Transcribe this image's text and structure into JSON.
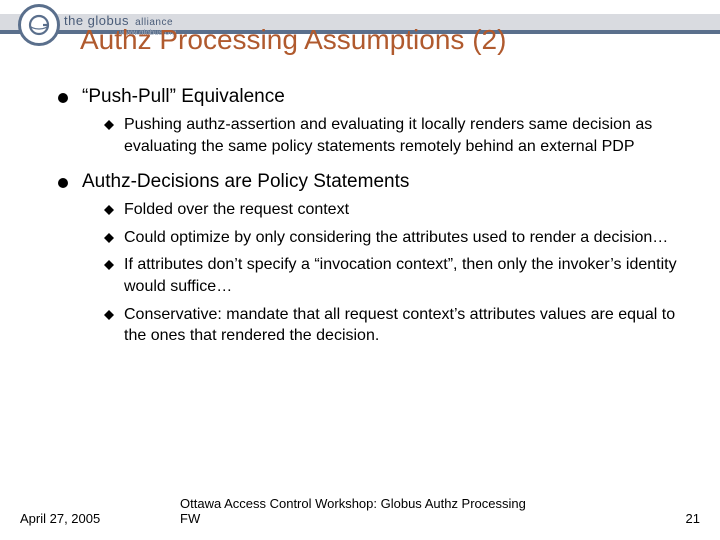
{
  "header": {
    "logo_text": "the globus",
    "logo_alliance": "alliance",
    "logo_url": "www.globus.org",
    "title": "Authz Processing Assumptions (2)"
  },
  "bullets": {
    "b1": {
      "label": "“Push-Pull” Equivalence",
      "subs": {
        "s1": "Pushing authz-assertion and evaluating it locally renders same decision as evaluating the same policy statements remotely behind an external PDP"
      }
    },
    "b2": {
      "label": "Authz-Decisions are Policy Statements",
      "subs": {
        "s1": "Folded over the request context",
        "s2": "Could optimize by only considering the attributes used to render a decision…",
        "s3": "If attributes don’t specify a “invocation context”, then only the invoker’s identity would suffice…",
        "s4": "Conservative: mandate that all request context’s attributes values are equal to the ones that rendered the decision."
      }
    }
  },
  "footer": {
    "date": "April 27, 2005",
    "center": "Ottawa Access Control Workshop: Globus Authz Processing FW",
    "page": "21"
  }
}
